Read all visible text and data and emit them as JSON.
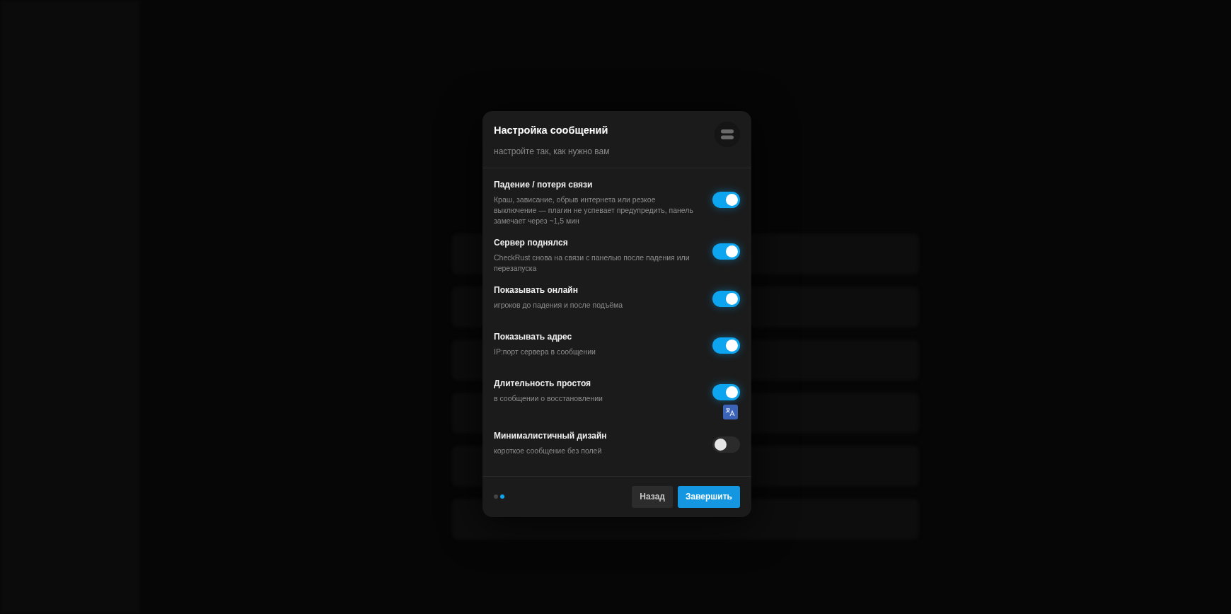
{
  "dialog": {
    "title": "Настройка сообщений",
    "subtitle": "настройте так, как нужно вам",
    "options": [
      {
        "label": "Падение / потеря связи",
        "description": "Краш, зависание, обрыв интернета или резкое выключение — плагин не успевает предупредить, панель замечает через ~1,5 мин",
        "on": true
      },
      {
        "label": "Сервер поднялся",
        "description": "CheckRust снова на связи с панелью после падения или перезапуска",
        "on": true
      },
      {
        "label": "Показывать онлайн",
        "description": "игроков до падения и после подъёма",
        "on": true
      },
      {
        "label": "Показывать адрес",
        "description": "IP:порт сервера в сообщении",
        "on": true
      },
      {
        "label": "Длительность простоя",
        "description": "в сообщении о восстановлении",
        "on": true
      },
      {
        "label": "Минималистичный дизайн",
        "description": "короткое сообщение без полей",
        "on": false
      }
    ],
    "steps": [
      {
        "selected": false
      },
      {
        "selected": true
      }
    ],
    "buttons": [
      {
        "label": "Назад",
        "kind": "secondary"
      },
      {
        "label": "Завершить",
        "kind": "primary"
      }
    ]
  }
}
